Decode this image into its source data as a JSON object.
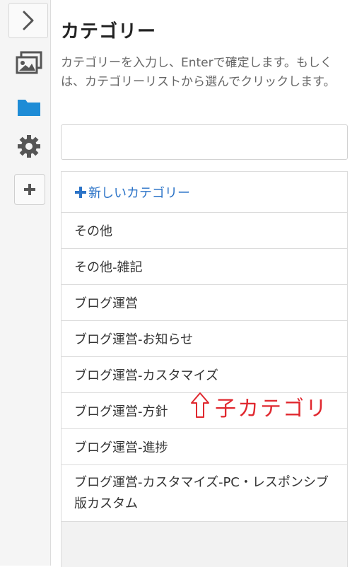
{
  "sidebar": {
    "toggle_icon": "chevron-right-icon",
    "icons": [
      "images-icon",
      "folder-icon",
      "gear-icon"
    ],
    "add_icon": "plus-icon",
    "accent": "#1e8cd6"
  },
  "panel": {
    "title": "カテゴリー",
    "description": "カテゴリーを入力し、Enterで確定します。もしくは、カテゴリーリストから選んでクリックします。",
    "input_value": "",
    "new_category_label": "新しいカテゴリー",
    "categories": [
      "その他",
      "その他-雑記",
      "ブログ運営",
      "ブログ運営-お知らせ",
      "ブログ運営-カスタマイズ",
      "ブログ運営-方針",
      "ブログ運営-進捗",
      "ブログ運営-カスタマイズ-PC・レスポンシブ版カスタム"
    ]
  },
  "annotation": {
    "text": "子カテゴリ",
    "arrow_icon": "up-arrow-icon",
    "color": "#e0282f"
  }
}
